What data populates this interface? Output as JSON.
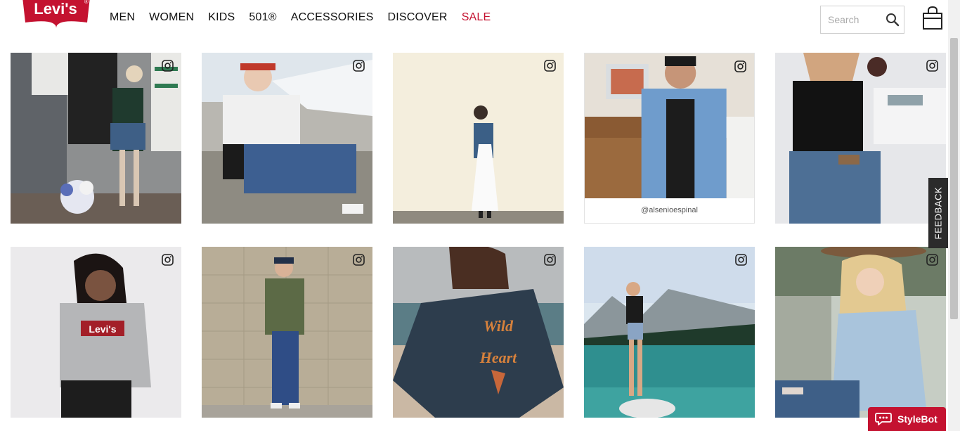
{
  "brand": {
    "logo_text": "Levi's",
    "logo_alt": "levis-batwing-logo",
    "brand_color": "#c41230"
  },
  "nav": {
    "items": [
      {
        "label": "MEN"
      },
      {
        "label": "WOMEN"
      },
      {
        "label": "KIDS"
      },
      {
        "label": "501®"
      },
      {
        "label": "ACCESSORIES"
      },
      {
        "label": "DISCOVER"
      },
      {
        "label": "SALE"
      }
    ]
  },
  "search": {
    "placeholder": "Search",
    "icon": "search-icon"
  },
  "cart": {
    "icon": "shopping-bag-icon"
  },
  "gallery": {
    "tiles": [
      {
        "icon": "instagram-icon"
      },
      {
        "icon": "instagram-icon"
      },
      {
        "icon": "instagram-icon"
      },
      {
        "icon": "instagram-icon",
        "caption": "@alsenioespinal"
      },
      {
        "icon": "instagram-icon"
      },
      {
        "icon": "instagram-icon"
      },
      {
        "icon": "instagram-icon"
      },
      {
        "icon": "instagram-icon"
      },
      {
        "icon": "instagram-icon"
      },
      {
        "icon": "instagram-icon"
      }
    ]
  },
  "feedback": {
    "label": "FEEDBACK"
  },
  "stylebot": {
    "label": "StyleBot",
    "icon": "chat-bubble-icon"
  }
}
